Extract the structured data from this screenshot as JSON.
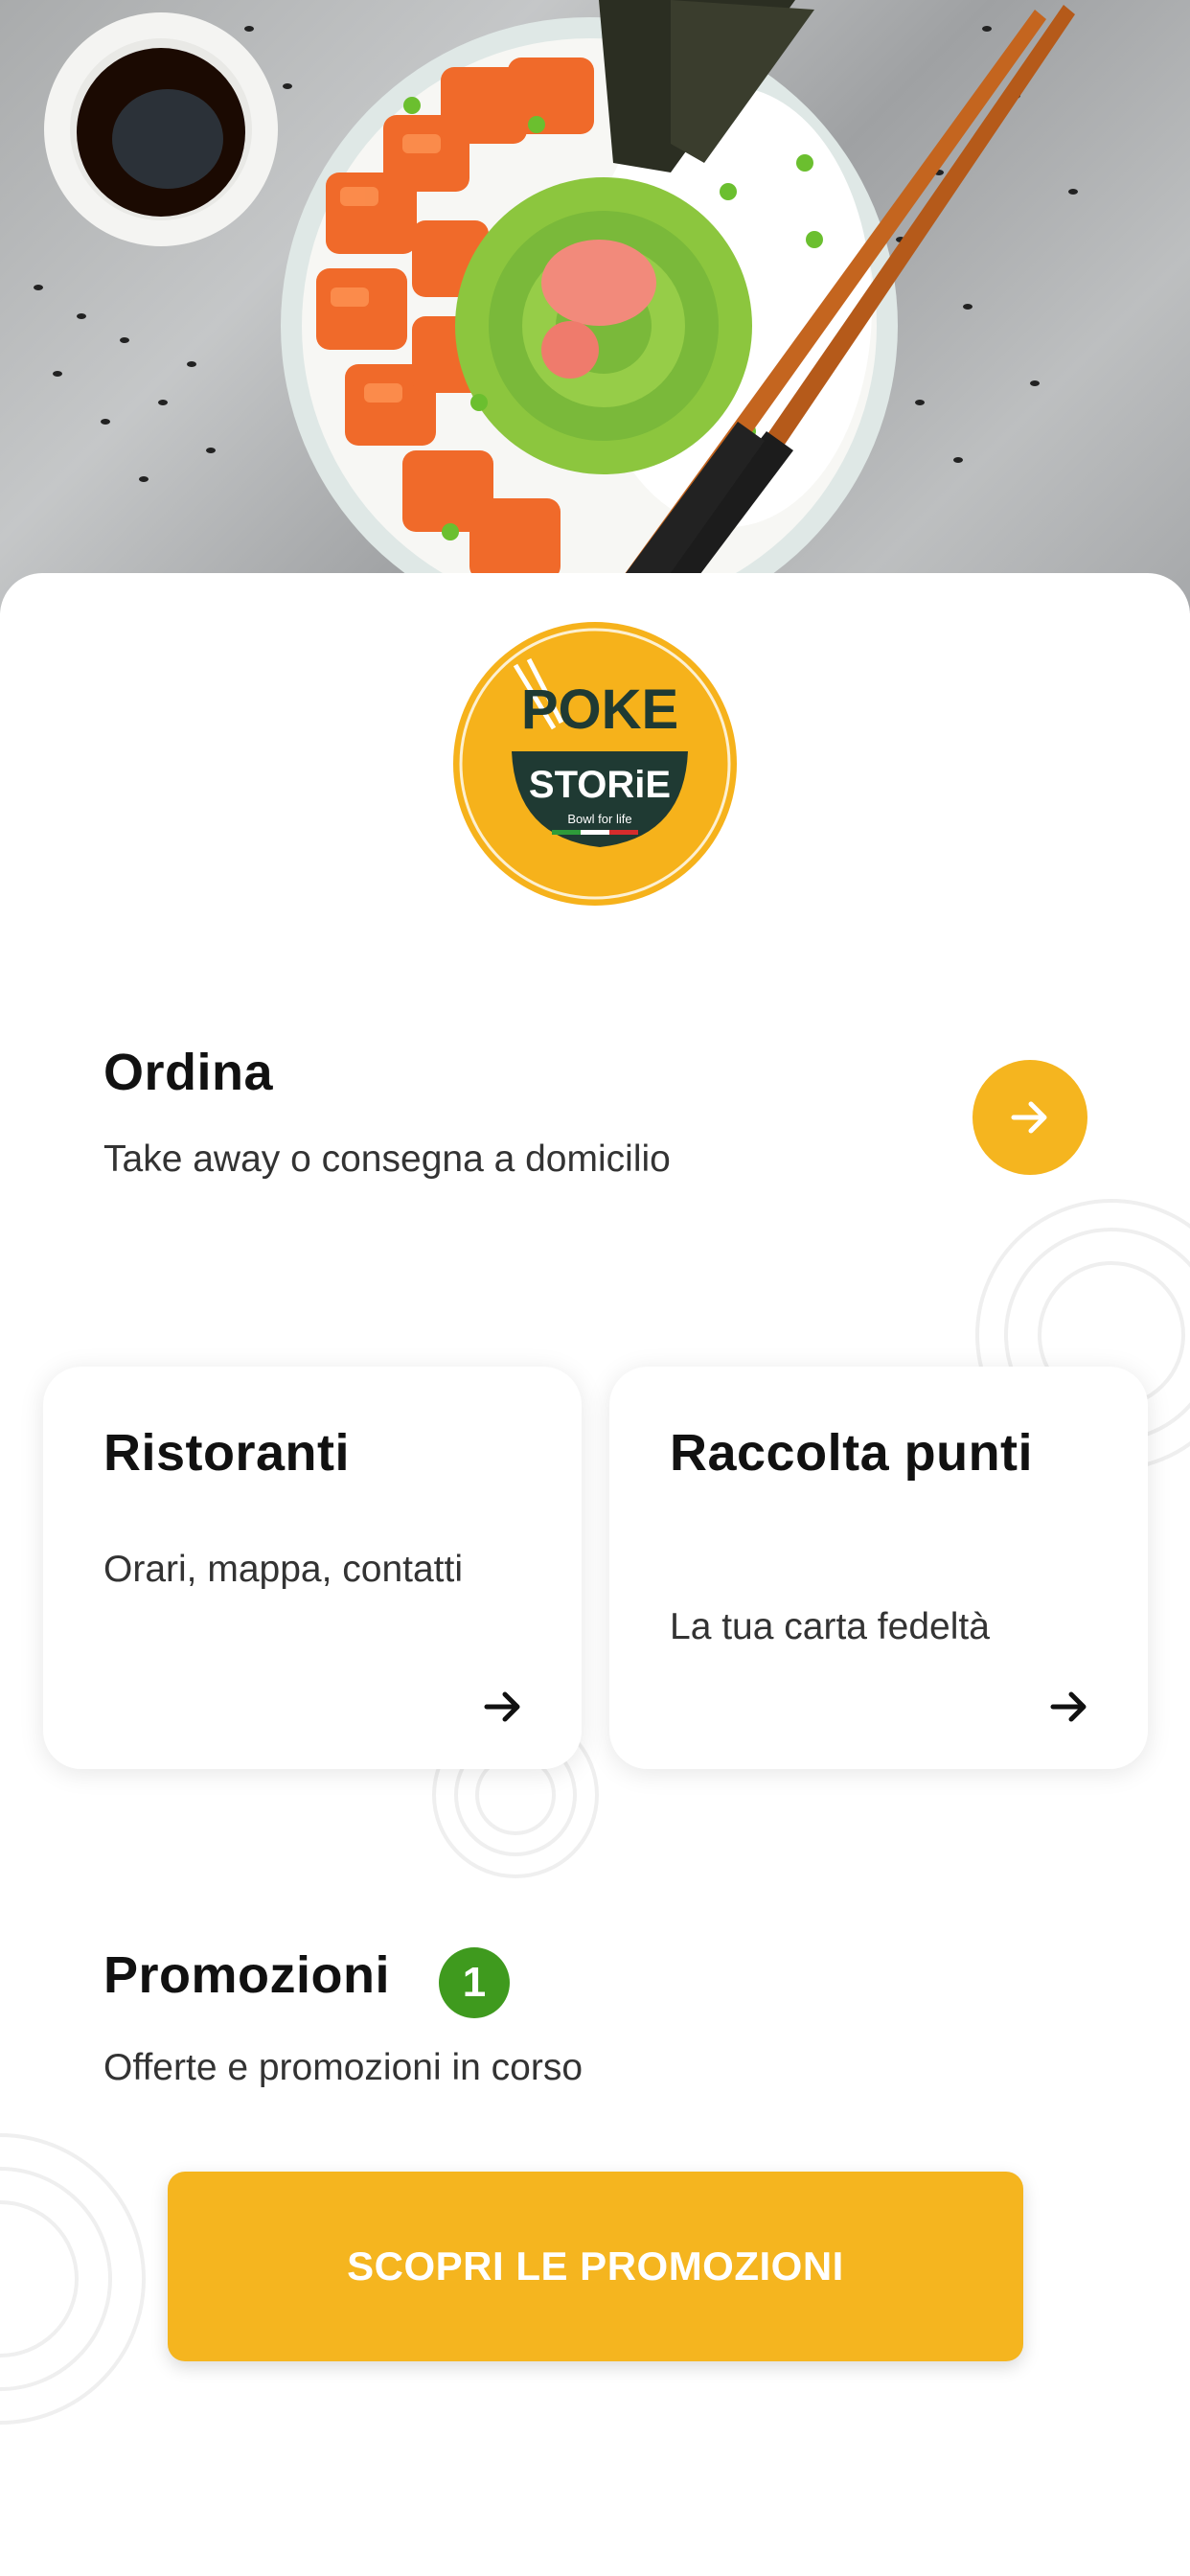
{
  "brand": {
    "logo_text_top": "POKE",
    "logo_text_bottom": "STORiE",
    "logo_tagline": "Bowl for life",
    "accent": "#f5b51f",
    "badge_color": "#3f9a1e"
  },
  "order": {
    "title": "Ordina",
    "subtitle": "Take away o consegna a domicilio",
    "action_icon": "arrow-right-icon"
  },
  "cards": [
    {
      "title": "Ristoranti",
      "subtitle": "Orari, mappa, contatti",
      "icon": "arrow-right-icon"
    },
    {
      "title": "Raccolta punti",
      "subtitle": "La tua carta fedeltà",
      "icon": "arrow-right-icon"
    }
  ],
  "promotions": {
    "title": "Promozioni",
    "badge_count": "1",
    "subtitle": "Offerte e promozioni in corso",
    "button_label": "SCOPRI LE PROMOZIONI"
  }
}
